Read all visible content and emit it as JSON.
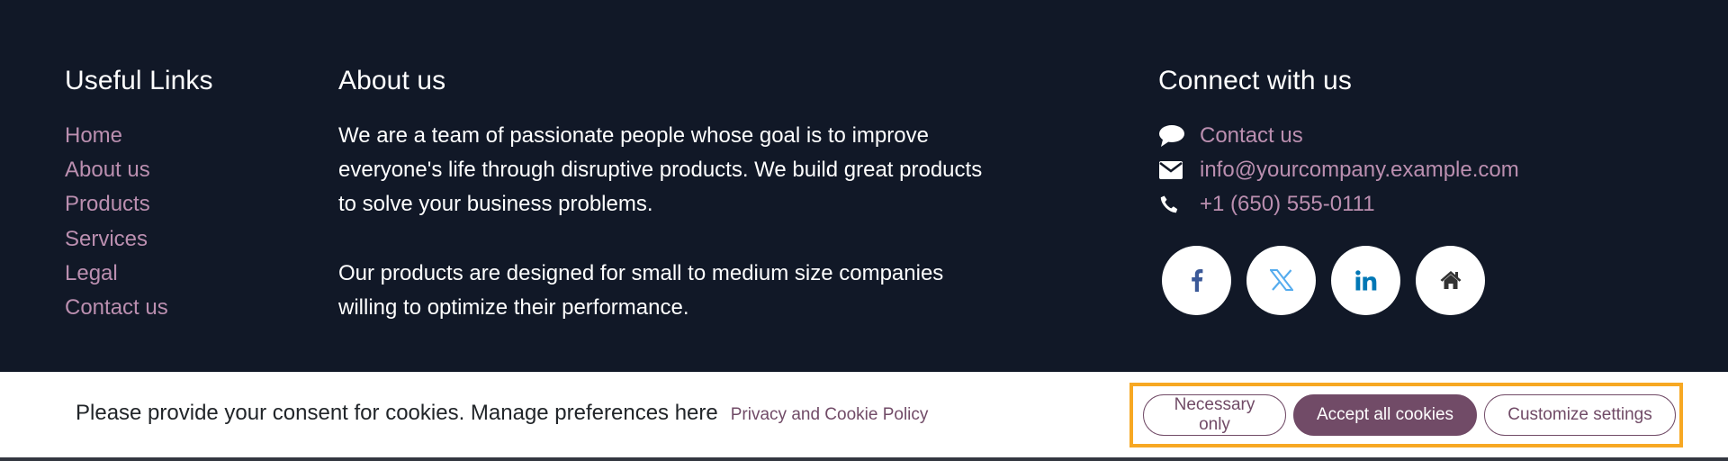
{
  "footer": {
    "useful_links": {
      "title": "Useful Links",
      "items": [
        "Home",
        "About us",
        "Products",
        "Services",
        "Legal",
        "Contact us"
      ]
    },
    "about": {
      "title": "About us",
      "paragraphs": [
        "We are a team of passionate people whose goal is to improve everyone's life through disruptive products. We build great products to solve your business problems.",
        "Our products are designed for small to medium size companies willing to optimize their performance."
      ]
    },
    "connect": {
      "title": "Connect with us",
      "items": [
        {
          "icon": "comment-icon",
          "label": "Contact us"
        },
        {
          "icon": "envelope-icon",
          "label": "info@yourcompany.example.com"
        },
        {
          "icon": "phone-icon",
          "label": "+1 (650) 555-0111"
        }
      ],
      "socials": [
        {
          "icon": "facebook-icon",
          "color": "#3b5998"
        },
        {
          "icon": "x-twitter-icon",
          "color": "#55acee"
        },
        {
          "icon": "linkedin-icon",
          "color": "#0077b5"
        },
        {
          "icon": "home-icon",
          "color": "#333333"
        }
      ]
    }
  },
  "cookie_bar": {
    "message": "Please provide your consent for cookies. Manage preferences here",
    "policy_link": "Privacy and Cookie Policy",
    "buttons": {
      "necessary": "Necessary only",
      "accept": "Accept all cookies",
      "customize": "Customize settings"
    }
  },
  "colors": {
    "background": "#111827",
    "link": "#bb8fb0",
    "primary": "#714b67",
    "highlight": "#f7a823"
  }
}
